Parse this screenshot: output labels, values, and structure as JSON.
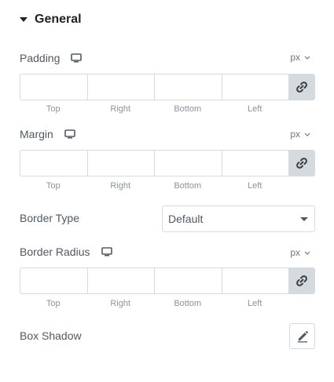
{
  "section": {
    "title": "General",
    "caret_icon": "caret-down-icon"
  },
  "padding": {
    "label": "Padding",
    "unit": "px",
    "device_icon": "desktop-icon",
    "values": {
      "top": "",
      "right": "",
      "bottom": "",
      "left": ""
    },
    "dim_labels": {
      "top": "Top",
      "right": "Right",
      "bottom": "Bottom",
      "left": "Left"
    },
    "link_icon": "link-icon"
  },
  "margin": {
    "label": "Margin",
    "unit": "px",
    "device_icon": "desktop-icon",
    "values": {
      "top": "",
      "right": "",
      "bottom": "",
      "left": ""
    },
    "dim_labels": {
      "top": "Top",
      "right": "Right",
      "bottom": "Bottom",
      "left": "Left"
    },
    "link_icon": "link-icon"
  },
  "border_type": {
    "label": "Border Type",
    "selected": "Default"
  },
  "border_radius": {
    "label": "Border Radius",
    "unit": "px",
    "device_icon": "desktop-icon",
    "values": {
      "top": "",
      "right": "",
      "bottom": "",
      "left": ""
    },
    "dim_labels": {
      "top": "Top",
      "right": "Right",
      "bottom": "Bottom",
      "left": "Left"
    },
    "link_icon": "link-icon"
  },
  "box_shadow": {
    "label": "Box Shadow",
    "edit_icon": "pencil-icon"
  },
  "colors": {
    "label_text": "#515962",
    "heading_text": "#1f2124",
    "border": "#d5dadf",
    "link_button_bg": "#d5dadf"
  }
}
